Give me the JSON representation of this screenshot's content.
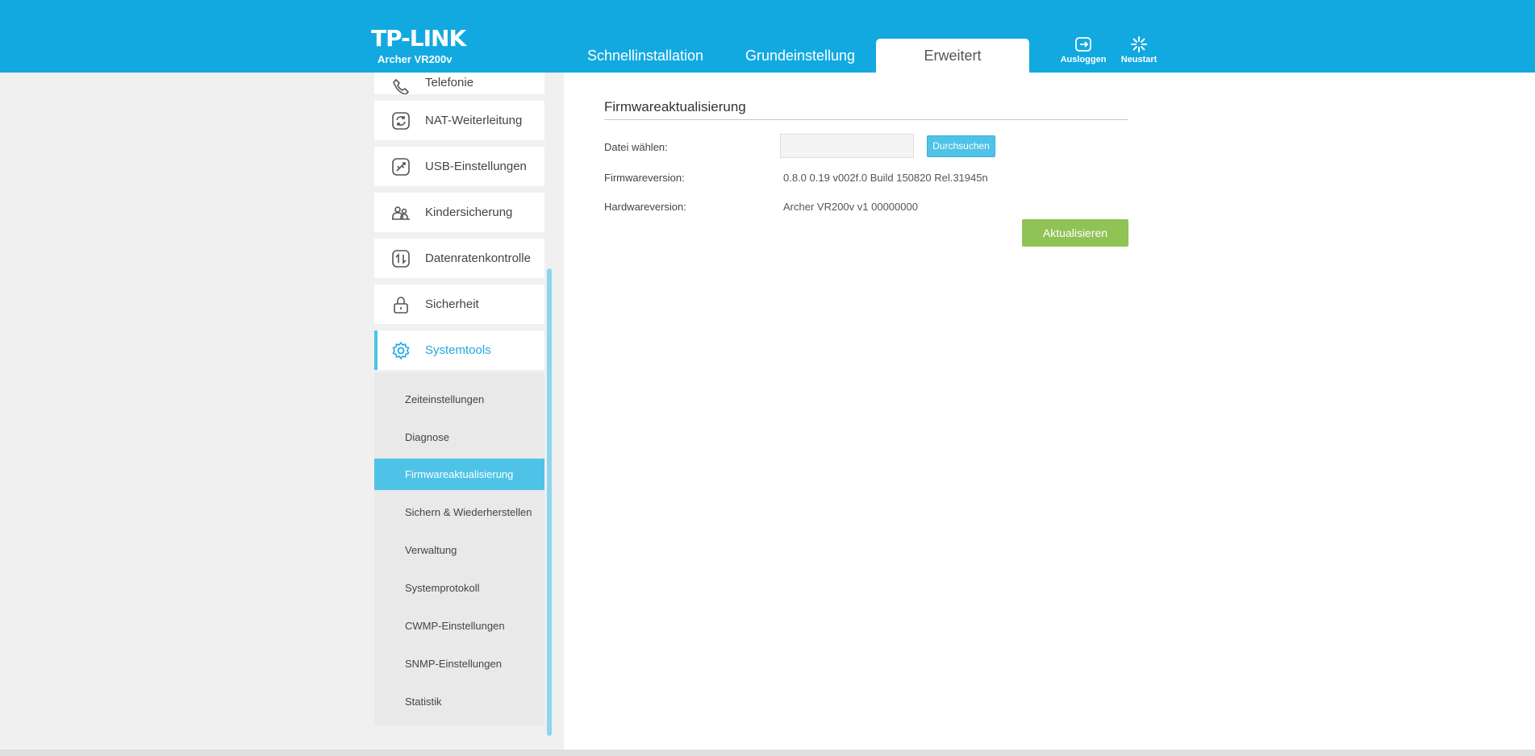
{
  "header": {
    "logo": "TP-LINK",
    "model": "Archer VR200v",
    "tabs": [
      {
        "label": "Schnellinstallation"
      },
      {
        "label": "Grundeinstellung"
      },
      {
        "label": "Erweitert"
      }
    ],
    "actions": {
      "logout_label": "Ausloggen",
      "restart_label": "Neustart"
    }
  },
  "sidebar": {
    "items": [
      {
        "label": "Telefonie",
        "icon": "phone-icon"
      },
      {
        "label": "NAT-Weiterleitung",
        "icon": "nat-forwarding-icon"
      },
      {
        "label": "USB-Einstellungen",
        "icon": "usb-icon"
      },
      {
        "label": "Kindersicherung",
        "icon": "parental-control-icon"
      },
      {
        "label": "Datenratenkontrolle",
        "icon": "bandwidth-icon"
      },
      {
        "label": "Sicherheit",
        "icon": "lock-icon"
      },
      {
        "label": "Systemtools",
        "icon": "gear-icon"
      }
    ],
    "submenu": [
      {
        "label": "Zeiteinstellungen"
      },
      {
        "label": "Diagnose"
      },
      {
        "label": "Firmwareaktualisierung"
      },
      {
        "label": "Sichern & Wiederherstellen"
      },
      {
        "label": "Verwaltung"
      },
      {
        "label": "Systemprotokoll"
      },
      {
        "label": "CWMP-Einstellungen"
      },
      {
        "label": "SNMP-Einstellungen"
      },
      {
        "label": "Statistik"
      }
    ]
  },
  "main": {
    "title": "Firmwareaktualisierung",
    "file_label": "Datei wählen:",
    "file_value": "",
    "browse_label": "Durchsuchen",
    "firmware_label": "Firmwareversion:",
    "firmware_value": "0.8.0 0.19 v002f.0 Build 150820 Rel.31945n",
    "hardware_label": "Hardwareversion:",
    "hardware_value": "Archer VR200v v1 00000000",
    "update_label": "Aktualisieren"
  },
  "colors": {
    "header": "#12a9e1",
    "accent": "#4ec3e7",
    "update_button": "#8fc356"
  }
}
